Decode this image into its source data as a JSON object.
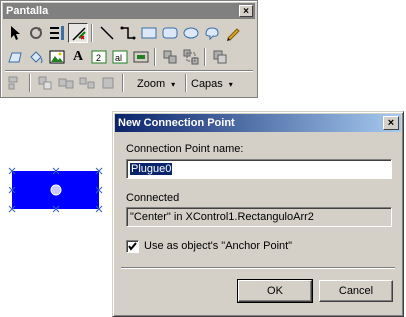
{
  "toolbar": {
    "title": "Pantalla",
    "close_label": "×",
    "zoom_label": "Zoom",
    "layers_label": "Capas",
    "text_tool_label": "A",
    "dropdown_arrow": "▾"
  },
  "dialog": {
    "title": "New Connection Point",
    "close_label": "×",
    "name_label": "Connection Point name:",
    "name_value": "Plugue0",
    "connected_label": "Connected",
    "connected_value": "\"Center\" in XControl1.RectanguloArr2",
    "anchor_checkbox_label": "Use as object's \"Anchor Point\"",
    "anchor_checked": true,
    "ok_label": "OK",
    "cancel_label": "Cancel"
  },
  "colors": {
    "shape_fill": "#0000ff",
    "title_active": "#0a246a",
    "title_inactive": "#808080",
    "face": "#d4d0c8"
  }
}
